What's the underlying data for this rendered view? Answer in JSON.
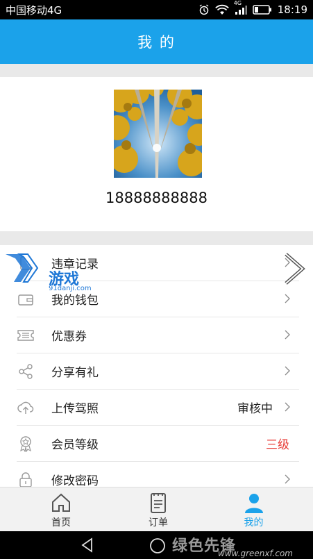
{
  "status_bar": {
    "carrier": "中国移动4G",
    "network": "4G",
    "time": "18:19"
  },
  "header": {
    "title": "我 的"
  },
  "profile": {
    "phone": "18888888888"
  },
  "menu": [
    {
      "label": "违章记录",
      "icon": "document-icon",
      "value": ""
    },
    {
      "label": "我的钱包",
      "icon": "wallet-icon",
      "value": ""
    },
    {
      "label": "优惠券",
      "icon": "ticket-icon",
      "value": ""
    },
    {
      "label": "分享有礼",
      "icon": "share-icon",
      "value": ""
    },
    {
      "label": "上传驾照",
      "icon": "cloud-upload-icon",
      "value": "审核中"
    },
    {
      "label": "会员等级",
      "icon": "medal-icon",
      "value": "三级"
    },
    {
      "label": "修改密码",
      "icon": "lock-icon",
      "value": ""
    }
  ],
  "watermark": {
    "brand": "游戏",
    "site": "91danji.com",
    "bottom_brand": "绿色先锋",
    "bottom_url": "www.greenxf.com"
  },
  "bottom_nav": [
    {
      "label": "首页",
      "icon": "home-icon"
    },
    {
      "label": "订单",
      "icon": "order-icon"
    },
    {
      "label": "我的",
      "icon": "user-icon"
    }
  ],
  "colors": {
    "accent": "#1ba2ea",
    "level_red": "#e8413c"
  }
}
